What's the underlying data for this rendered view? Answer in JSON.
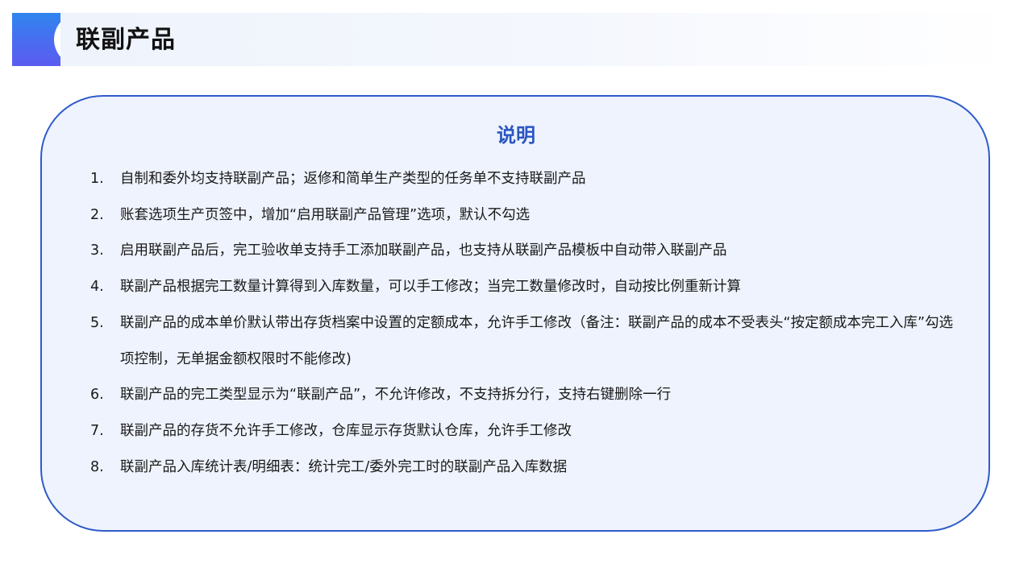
{
  "header": {
    "title": "联副产品"
  },
  "panel": {
    "title": "说明",
    "items": [
      {
        "num": "1.",
        "text": "自制和委外均支持联副产品；返修和简单生产类型的任务单不支持联副产品"
      },
      {
        "num": "2.",
        "text": "账套选项生产页签中，增加“启用联副产品管理”选项，默认不勾选"
      },
      {
        "num": "3.",
        "text": "启用联副产品后，完工验收单支持手工添加联副产品，也支持从联副产品模板中自动带入联副产品"
      },
      {
        "num": "4.",
        "text": "联副产品根据完工数量计算得到入库数量，可以手工修改；当完工数量修改时，自动按比例重新计算"
      },
      {
        "num": "5.",
        "text": "联副产品的成本单价默认带出存货档案中设置的定额成本，允许手工修改（备注：联副产品的成本不受表头“按定额成本完工入库”勾选 项控制，无单据金额权限时不能修改)"
      },
      {
        "num": "6.",
        "text": "联副产品的完工类型显示为“联副产品”，不允许修改，不支持拆分行，支持右键删除一行"
      },
      {
        "num": "7.",
        "text": "联副产品的存货不允许手工修改，仓库显示存货默认仓库，允许手工修改"
      },
      {
        "num": "8.",
        "text": "联副产品入库统计表/明细表：统计完工/委外完工时的联副产品入库数据"
      }
    ]
  },
  "colors": {
    "accent": "#2f5bc9",
    "title_blue": "#2a55c2",
    "panel_bg": "#eef3fd"
  }
}
